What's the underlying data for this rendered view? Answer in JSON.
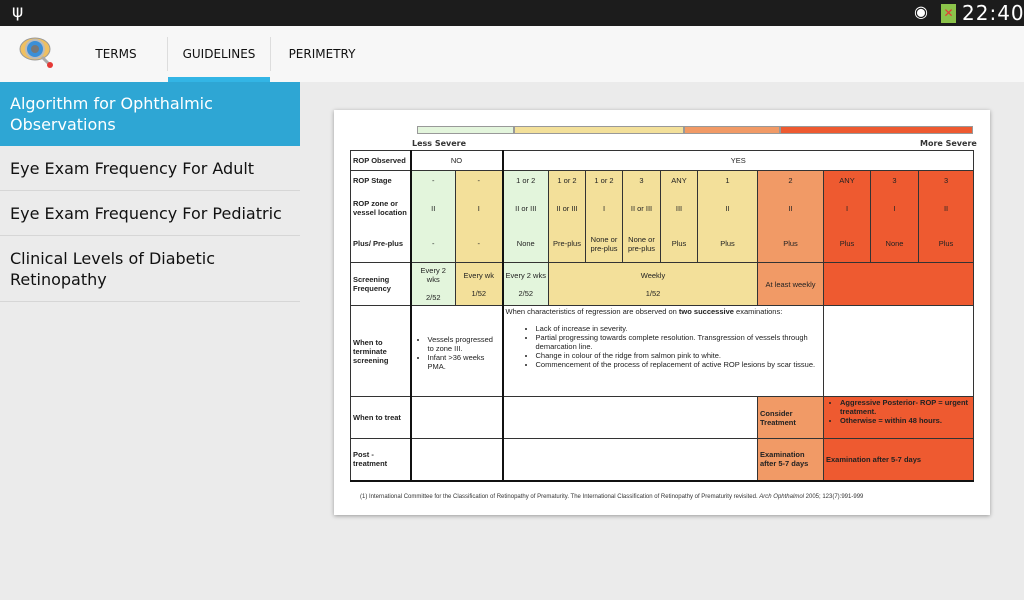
{
  "status": {
    "time": "22:40",
    "icons": [
      "usb-icon",
      "wifi-icon",
      "battery-icon"
    ]
  },
  "tabs": [
    {
      "label": "TERMS"
    },
    {
      "label": "GUIDELINES",
      "selected": true
    },
    {
      "label": "PERIMETRY"
    }
  ],
  "sidebar": {
    "items": [
      {
        "label": "Algorithm for Ophthalmic Observations",
        "selected": true
      },
      {
        "label": "Eye Exam Frequency For Adult"
      },
      {
        "label": "Eye Exam Frequency For Pediatric"
      },
      {
        "label": "Clinical Levels of Diabetic Retinopathy"
      }
    ]
  },
  "doc": {
    "less_severe": "Less Severe",
    "more_severe": "More Severe",
    "labels": {
      "observed": "ROP Observed",
      "stage": "ROP Stage",
      "zone": "ROP zone or vessel location",
      "plus": "Plus/ Pre-plus",
      "screening": "Screening Frequency",
      "terminate": "When to terminate screening",
      "treat": "When to treat",
      "post": "Post - treatment"
    },
    "no": "NO",
    "yes": "YES",
    "stage": [
      "-",
      "-",
      "1 or 2",
      "1 or 2",
      "1 or 2",
      "3",
      "ANY",
      "1",
      "2",
      "ANY",
      "3",
      "3"
    ],
    "zone": [
      "II",
      "I",
      "II or III",
      "II or III",
      "I",
      "II or III",
      "III",
      "II",
      "II",
      "I",
      "I",
      "II"
    ],
    "plus": [
      "-",
      "-",
      "None",
      "Pre-plus",
      "None or pre-plus",
      "None or pre-plus",
      "Plus",
      "Plus",
      "Plus",
      "Plus",
      "None",
      "Plus"
    ],
    "screening": {
      "c1": "Every 2 wks",
      "c1f": "2/52",
      "c2": "Every wk",
      "c2f": "1/52",
      "c3": "Every 2 wks",
      "c3f": "2/52",
      "weekly": "Weekly",
      "weeklyf": "1/52",
      "orange": "At least weekly"
    },
    "terminate": {
      "no_bullets": [
        "Vessels progressed to zone III.",
        "Infant >36 weeks PMA."
      ],
      "yes_intro_a": "When characteristics of regression are observed on ",
      "yes_intro_b": "two successive",
      "yes_intro_c": " examinations:",
      "yes_bullets": [
        "Lack of increase in severity.",
        "Partial progressing towards complete resolution. Transgression of vessels through demarcation line.",
        "Change in colour of the ridge from salmon pink to white.",
        "Commencement of the process of replacement of active ROP lesions by scar tissue."
      ]
    },
    "treat": {
      "orange": "Consider Treatment",
      "red_bullets": [
        "Aggressive Posterior- ROP = urgent treatment.",
        "Otherwise = within 48 hours."
      ]
    },
    "post": {
      "orange": "Examination after 5-7 days",
      "red": "Examination after 5-7 days"
    },
    "footnote_a": "(1) International Committee for the Classification of Retinopathy of Prematurity. The International Classification of Retinopathy of Prematurity revisited. ",
    "footnote_b": "Arch Ophthalmol",
    "footnote_c": " 2005; 123(7):991-999"
  },
  "colors": {
    "accent": "#2ea6d4",
    "green": "#e3f5dc",
    "yellow": "#f3e09a",
    "orange": "#f19a66",
    "red": "#ee5a30"
  }
}
